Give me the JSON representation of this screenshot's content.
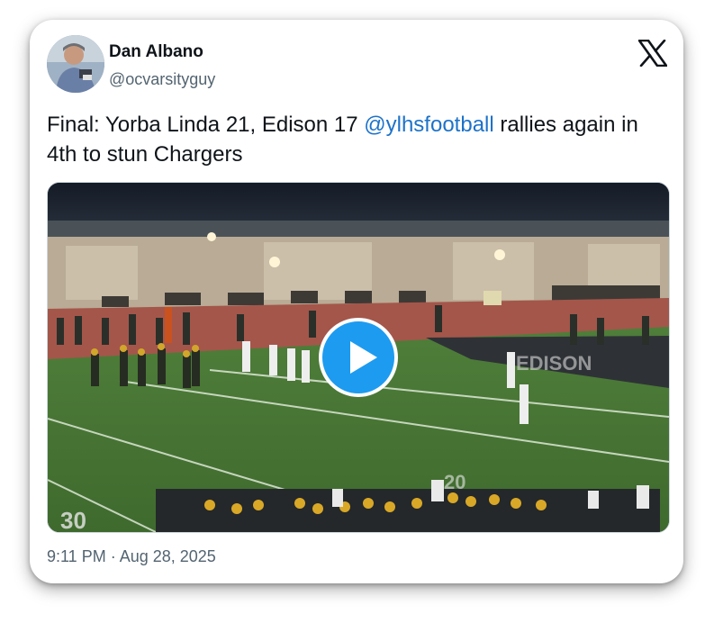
{
  "author": {
    "display_name": "Dan Albano",
    "handle": "@ocvarsityguy"
  },
  "tweet": {
    "text_before": "Final: Yorba Linda 21, Edison 17 ",
    "mention": "@ylhsfootball",
    "text_after": " rallies again in 4th to stun Chargers"
  },
  "media": {
    "type": "video",
    "play_icon": "play-icon"
  },
  "meta": {
    "timestamp": "9:11 PM · Aug 28, 2025"
  },
  "brand": {
    "logo_icon": "x-logo-icon",
    "accent_color": "#1d9bf0",
    "mention_color": "#1d72c9"
  }
}
